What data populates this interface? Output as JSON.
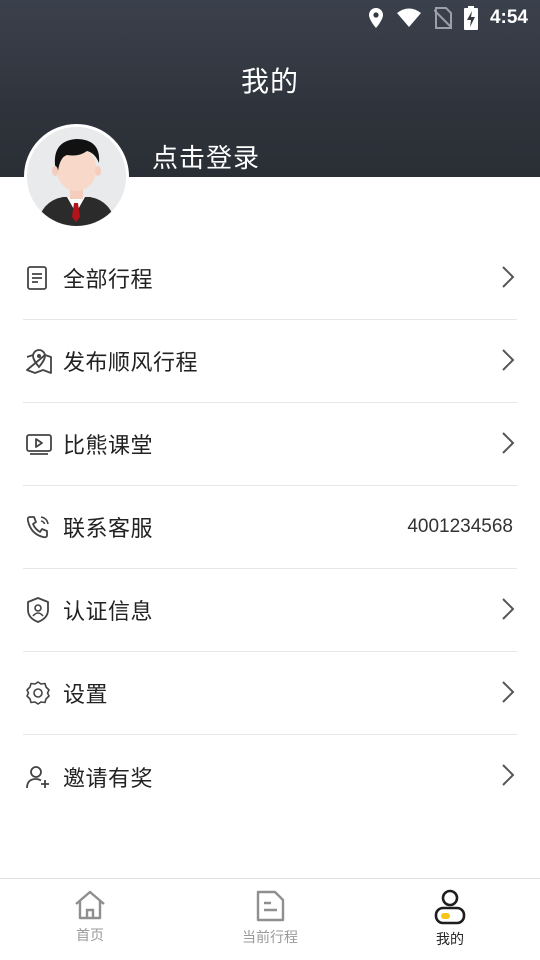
{
  "status_bar": {
    "time": "4:54",
    "icons": [
      "location-icon",
      "wifi-icon",
      "no-sim-icon",
      "battery-charging-icon"
    ]
  },
  "header": {
    "title": "我的",
    "login_prompt": "点击登录"
  },
  "menu": [
    {
      "label": "全部行程",
      "icon": "document-icon"
    },
    {
      "label": "发布顺风行程",
      "icon": "map-pin-icon"
    },
    {
      "label": "比熊课堂",
      "icon": "video-icon"
    },
    {
      "label": "联系客服",
      "icon": "phone-icon",
      "value": "4001234568"
    },
    {
      "label": "认证信息",
      "icon": "shield-user-icon"
    },
    {
      "label": "设置",
      "icon": "gear-icon"
    },
    {
      "label": "邀请有奖",
      "icon": "user-add-icon"
    }
  ],
  "tabbar": [
    {
      "label": "首页",
      "icon": "home-icon"
    },
    {
      "label": "当前行程",
      "icon": "itinerary-icon"
    },
    {
      "label": "我的",
      "icon": "profile-icon",
      "active": true
    }
  ],
  "colors": {
    "header_top": "#3b414c",
    "header_bottom": "#2a2e35",
    "accent_yellow": "#f5c518"
  }
}
